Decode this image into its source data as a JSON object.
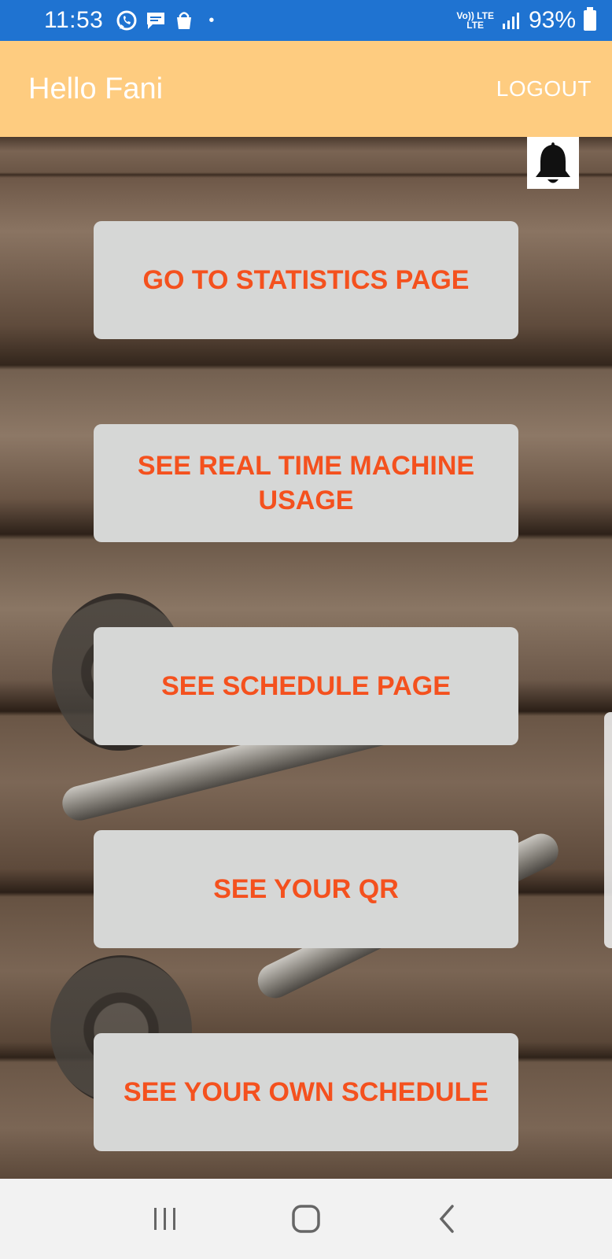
{
  "status_bar": {
    "time": "11:53",
    "icons_left": [
      "whatsapp-icon",
      "message-icon",
      "shopping-bag-icon"
    ],
    "network_top": "Vo)) LTE",
    "network_bottom": "LTE",
    "battery": "93%"
  },
  "app_bar": {
    "title": "Hello Fani",
    "logout_label": "LOGOUT"
  },
  "notification": {
    "icon": "bell-icon"
  },
  "menu": {
    "statistics": "GO TO STATISTICS PAGE",
    "realtime_line1": "SEE REAL TIME MACHINE",
    "realtime_line2": "USAGE",
    "schedule": "SEE SCHEDULE PAGE",
    "qr": "SEE YOUR QR",
    "own_schedule": "SEE YOUR OWN SCHEDULE"
  },
  "colors": {
    "status_bar": "#1f73d1",
    "app_bar": "#fecc80",
    "button_bg": "#d6d7d6",
    "button_text": "#f4511e",
    "nav_bar": "#f2f2f2"
  },
  "nav_bar": {
    "items": [
      "recent-apps-icon",
      "home-icon",
      "back-icon"
    ]
  }
}
